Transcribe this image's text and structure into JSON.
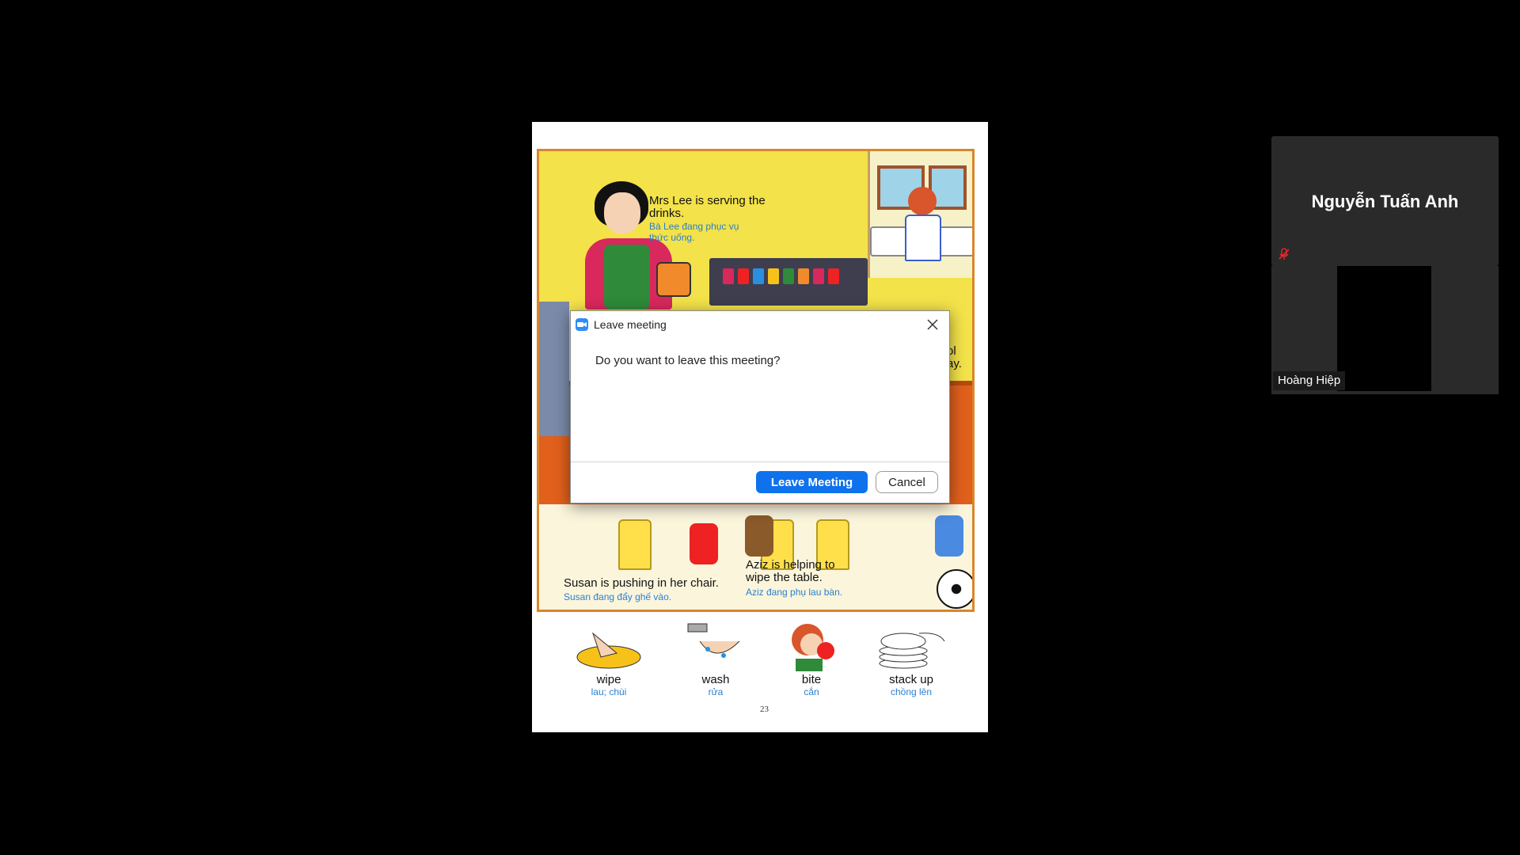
{
  "document": {
    "captions": {
      "mrs_lee_en": "Mrs Lee is serving the drinks.",
      "mrs_lee_vi": "Bà Lee đang phục vụ thức uống.",
      "partial_line1": "ol",
      "partial_line2": "ay.",
      "susan_en": "Susan is pushing in her chair.",
      "susan_vi": "Susan đang đẩy ghế vào.",
      "aziz_en_1": "Aziz is helping to",
      "aziz_en_2": "wipe the table.",
      "aziz_vi": "Aziz đang phụ lau bàn."
    },
    "vocab": [
      {
        "word": "wipe",
        "vi": "lau; chùi"
      },
      {
        "word": "wash",
        "vi": "rửa"
      },
      {
        "word": "bite",
        "vi": "cắn"
      },
      {
        "word": "stack up",
        "vi": "chồng lên"
      }
    ],
    "page_number": "23"
  },
  "dialog": {
    "title": "Leave meeting",
    "message": "Do you want to leave this meeting?",
    "leave_label": "Leave Meeting",
    "cancel_label": "Cancel"
  },
  "participants": {
    "name_tile": "Nguyễn Tuấn Anh",
    "video_tile_label": "Hoàng Hiệp",
    "muted_icon": "mic-muted-icon"
  },
  "colors": {
    "primary_button": "#0e72ed",
    "app_icon": "#2d8cff",
    "muted_red": "#e02828"
  }
}
